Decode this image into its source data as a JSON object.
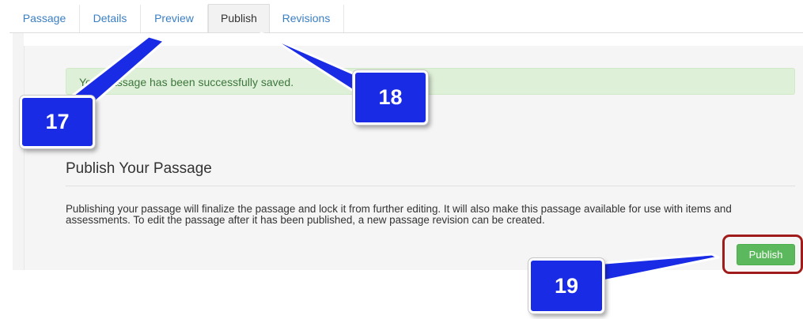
{
  "tabs": [
    {
      "label": "Passage",
      "active": false
    },
    {
      "label": "Details",
      "active": false
    },
    {
      "label": "Preview",
      "active": false
    },
    {
      "label": "Publish",
      "active": true
    },
    {
      "label": "Revisions",
      "active": false
    }
  ],
  "alert": {
    "text": "Your passage has been successfully saved."
  },
  "publish_section": {
    "heading": "Publish Your Passage",
    "description": "Publishing your passage will finalize the passage and lock it from further editing. It will also make this passage available for use with items and assessments. To edit the passage after it has been published, a new passage revision can be created.",
    "button_label": "Publish"
  },
  "callouts": [
    {
      "number": "17"
    },
    {
      "number": "18"
    },
    {
      "number": "19"
    }
  ],
  "colors": {
    "tab_link": "#3a7fc4",
    "alert_bg": "#dff0d8",
    "alert_text": "#3c763d",
    "button_green": "#5cb85c",
    "callout_blue": "#1a2be6",
    "highlight_red": "#a01c1c"
  }
}
